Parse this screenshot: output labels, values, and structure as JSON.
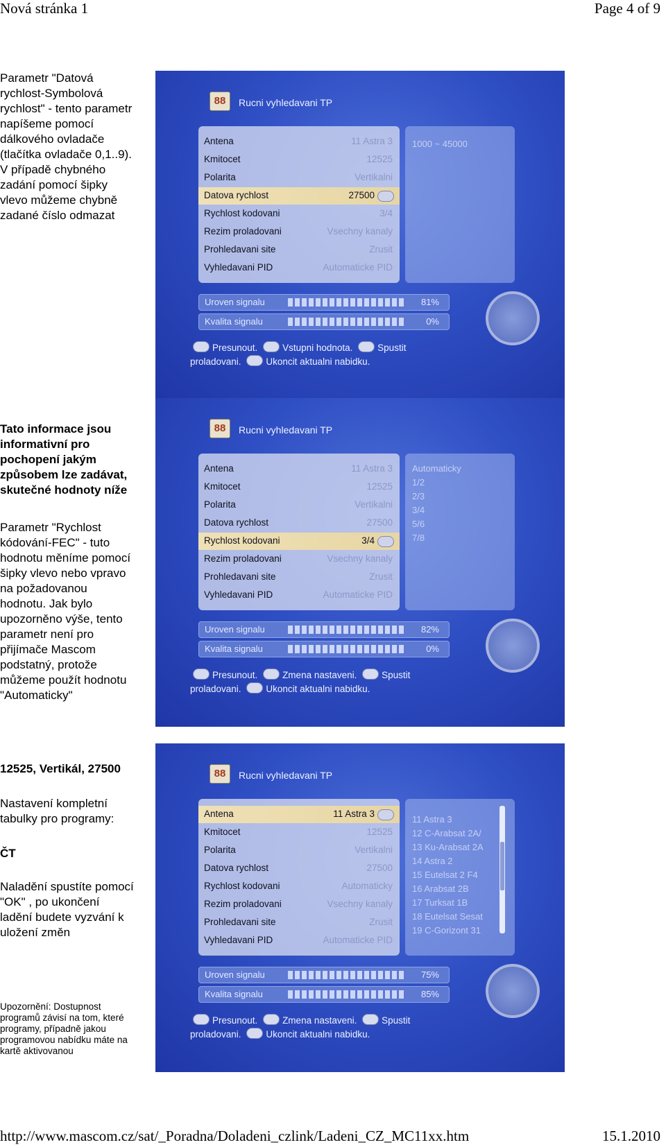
{
  "header": {
    "left": "Nová stránka 1",
    "right": "Page 4 of 9"
  },
  "footer": {
    "left": "http://www.mascom.cz/sat/_Poradna/Doladeni_czlink/Ladeni_CZ_MC11xx.htm",
    "right": "15.1.2010"
  },
  "text1": {
    "lines": [
      "Parametr \"Datová",
      "rychlost-Symbolová",
      "rychlost\" - tento parametr",
      "napíšeme pomocí",
      "dálkového ovladače",
      "(tlačítka ovladače 0,1..9).",
      "V případě chybného",
      "zadání pomocí šipky",
      "vlevo můžeme chybně",
      "zadané číslo odmazat"
    ]
  },
  "text2": {
    "bold_lines": [
      "Tato informace jsou",
      "informativní pro",
      "pochopení jakým",
      "způsobem lze zadávat,",
      "skutečné hodnoty níže"
    ],
    "lines": [
      "Parametr \"Rychlost",
      "kódování-FEC\" -  tuto",
      "hodnotu měníme pomocí",
      "šipky vlevo nebo vpravo",
      "na požadovanou",
      "hodnotu. Jak bylo",
      "upozorněno výše, tento",
      "parametr není pro",
      "přijímače Mascom",
      "podstatný, protože",
      "můžeme použít hodnotu",
      "\"Automaticky\""
    ]
  },
  "text3": {
    "heading": "12525, Vertikál, 27500",
    "p1": [
      "Nastavení kompletní",
      "tabulky pro programy:"
    ],
    "p2": "ČT",
    "p3": [
      "Naladění spustíte pomocí",
      "\"OK\" , po ukončení",
      "ladění budete vyzvání k",
      "uložení změn"
    ],
    "note": [
      "Upozornění: Dostupnost",
      "programů závisí na tom, které",
      "programy, případně jakou",
      "programovou nabídku máte na",
      "kartě aktivovanou"
    ]
  },
  "screen_common": {
    "logo": "88",
    "title": "Rucni vyhledavani TP",
    "labels": [
      "Antena",
      "Kmitocet",
      "Polarita",
      "Datova rychlost",
      "Rychlost kodovani",
      "Rezim proladovani",
      "Prohledavani site",
      "Vyhledavani PID"
    ],
    "bar1": "Uroven signalu",
    "bar2": "Kvalita signalu",
    "help_move": "Presunout.",
    "help_start": "Spustit",
    "help_line2a": "proladovani.",
    "help_exit": "Ukoncit aktualni nabidku."
  },
  "screen1": {
    "values": [
      "11 Astra 3",
      "12525",
      "Vertikalni",
      "27500",
      "3/4",
      "Vsechny kanaly",
      "Zrusit",
      "Automaticke PID"
    ],
    "side": [
      "1000 ~ 45000"
    ],
    "pct1": "81%",
    "pct2": "0%",
    "help_mid": "Vstupni hodnota.",
    "level_signal": 0.81,
    "level_quality": 0.0
  },
  "screen2": {
    "values": [
      "11 Astra 3",
      "12525",
      "Vertikalni",
      "27500",
      "3/4",
      "Vsechny kanaly",
      "Zrusit",
      "Automaticke PID"
    ],
    "side": [
      "Automaticky",
      "1/2",
      "2/3",
      "3/4",
      "5/6",
      "7/8"
    ],
    "pct1": "82%",
    "pct2": "0%",
    "help_mid": "Zmena nastaveni.",
    "level_signal": 0.82,
    "level_quality": 0.0
  },
  "screen3": {
    "values": [
      "11 Astra 3",
      "12525",
      "Vertikalni",
      "27500",
      "Automaticky",
      "Vsechny kanaly",
      "Zrusit",
      "Automaticke PID"
    ],
    "side": [
      "11 Astra 3",
      "12 C-Arabsat 2A/",
      "13 Ku-Arabsat 2A",
      "14 Astra 2",
      "15 Eutelsat 2 F4",
      "16 Arabsat 2B",
      "17 Turksat 1B",
      "18 Eutelsat Sesat",
      "19 C-Gorizont 31"
    ],
    "pct1": "75%",
    "pct2": "85%",
    "help_mid": "Zmena nastaveni.",
    "level_signal": 0.75,
    "level_quality": 0.85
  }
}
